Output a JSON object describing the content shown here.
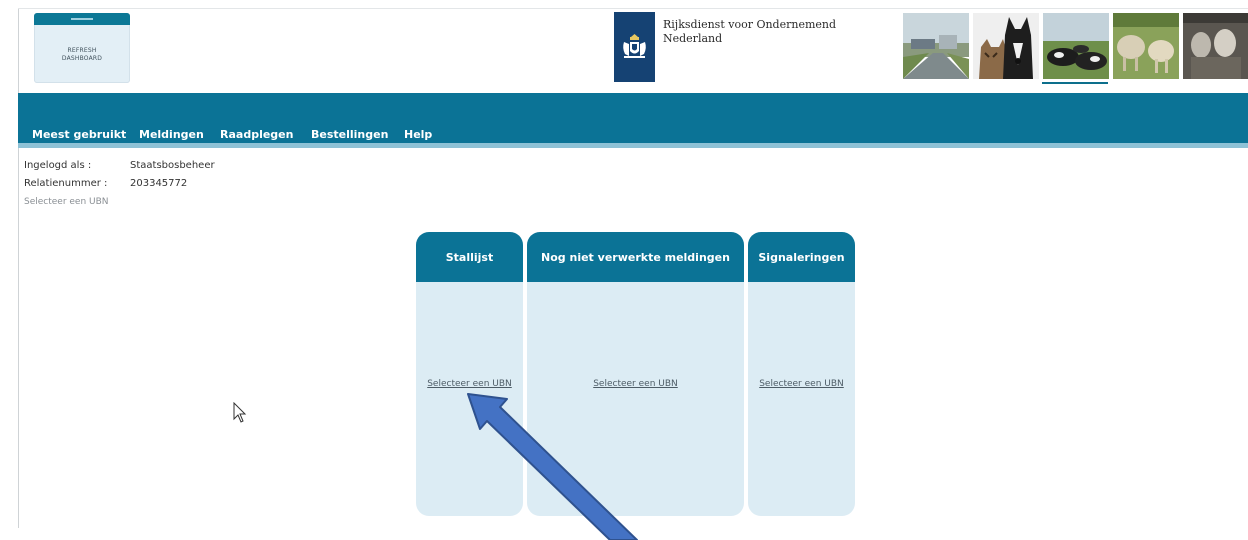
{
  "header": {
    "refresh_button": "REFRESH\nDASHBOARD",
    "logo_text": "Rijksdienst voor Ondernemend\nNederland",
    "photos": [
      "road-landscape-photo",
      "cat-dog-photo",
      "cows-meadow-photo",
      "sheep-goats-photo",
      "goats-barn-photo"
    ]
  },
  "nav": {
    "items": [
      "Meest gebruikt",
      "Meldingen",
      "Raadplegen",
      "Bestellingen",
      "Help"
    ]
  },
  "user_info": {
    "logged_in_label": "Ingelogd als :",
    "logged_in_value": "Staatsbosbeheer",
    "relation_label": "Relatienummer :",
    "relation_value": "203345772",
    "select_ubn": "Selecteer een UBN"
  },
  "cards": [
    {
      "title": "Stallijst",
      "link": "Selecteer een UBN"
    },
    {
      "title": "Nog niet verwerkte meldingen",
      "link": "Selecteer een UBN"
    },
    {
      "title": "Signaleringen",
      "link": "Selecteer een UBN"
    }
  ],
  "colors": {
    "brand_teal": "#0b7396",
    "card_background": "#dcecf4",
    "logo_blue": "#154273",
    "annotation_arrow": "#4472c4"
  }
}
